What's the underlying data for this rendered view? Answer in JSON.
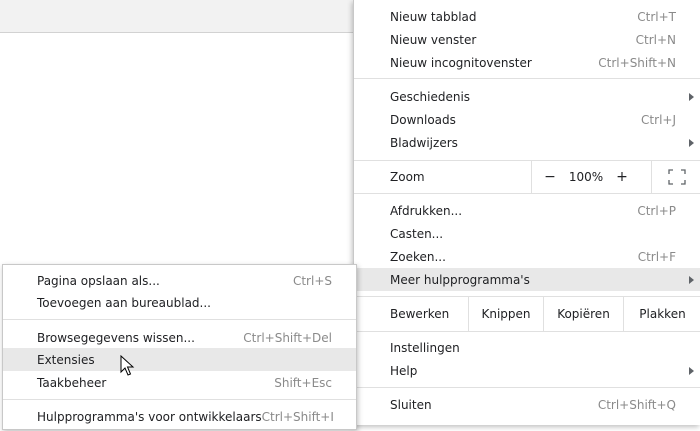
{
  "main_menu": {
    "items": [
      {
        "label": "Nieuw tabblad",
        "shortcut": "Ctrl+T"
      },
      {
        "label": "Nieuw venster",
        "shortcut": "Ctrl+N"
      },
      {
        "label": "Nieuw incognitovenster",
        "shortcut": "Ctrl+Shift+N"
      },
      {
        "label": "Geschiedenis",
        "shortcut": ""
      },
      {
        "label": "Downloads",
        "shortcut": "Ctrl+J"
      },
      {
        "label": "Bladwijzers",
        "shortcut": ""
      },
      {
        "label": "Afdrukken...",
        "shortcut": "Ctrl+P"
      },
      {
        "label": "Casten...",
        "shortcut": ""
      },
      {
        "label": "Zoeken...",
        "shortcut": "Ctrl+F"
      },
      {
        "label": "Meer hulpprogramma's",
        "shortcut": ""
      },
      {
        "label": "Instellingen",
        "shortcut": ""
      },
      {
        "label": "Help",
        "shortcut": ""
      },
      {
        "label": "Sluiten",
        "shortcut": "Ctrl+Shift+Q"
      }
    ],
    "zoom": {
      "label": "Zoom",
      "minus": "−",
      "value": "100%",
      "plus": "+"
    },
    "edit": {
      "label": "Bewerken",
      "cut": "Knippen",
      "copy": "Kopiëren",
      "paste": "Plakken"
    }
  },
  "sub_menu": {
    "items": [
      {
        "label": "Pagina opslaan als...",
        "shortcut": "Ctrl+S"
      },
      {
        "label": "Toevoegen aan bureaublad...",
        "shortcut": ""
      },
      {
        "label": "Browsegegevens wissen...",
        "shortcut": "Ctrl+Shift+Del"
      },
      {
        "label": "Extensies",
        "shortcut": ""
      },
      {
        "label": "Taakbeheer",
        "shortcut": "Shift+Esc"
      },
      {
        "label": "Hulpprogramma's voor ontwikkelaars",
        "shortcut": "Ctrl+Shift+I"
      }
    ]
  },
  "colors": {
    "hover": "#e8e8e8",
    "shortcut": "#8a8a8a",
    "separator": "#e0e0e0"
  }
}
